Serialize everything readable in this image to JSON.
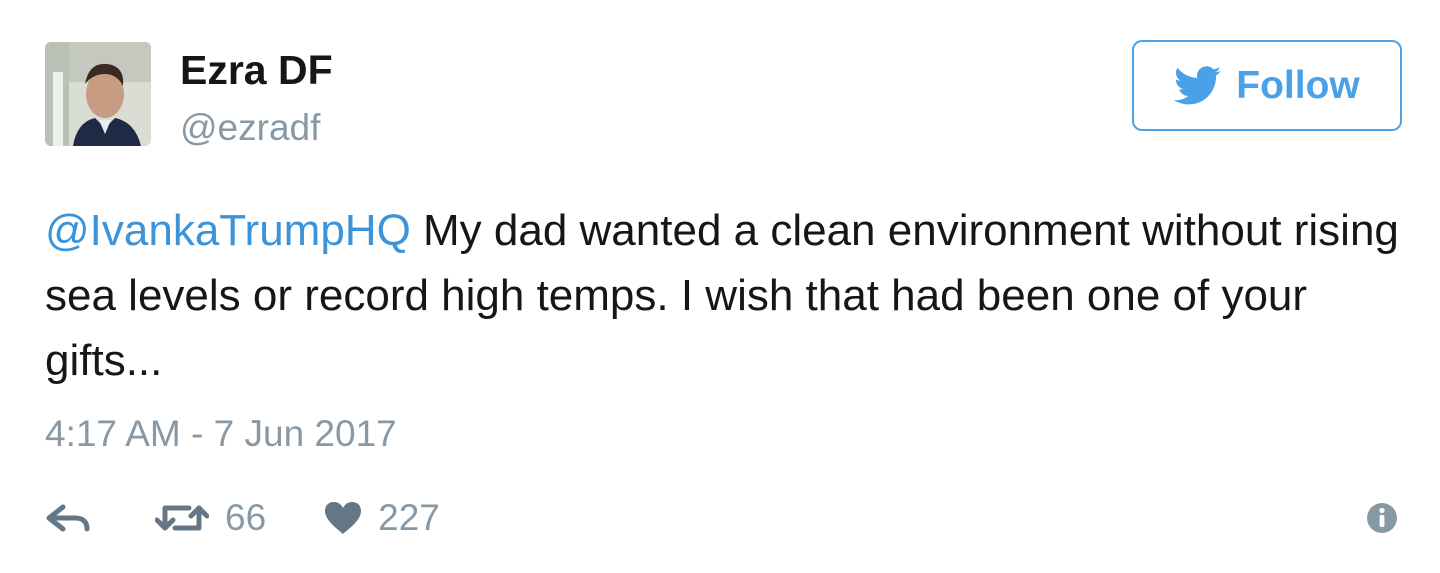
{
  "tweet": {
    "author": {
      "display_name": "Ezra DF",
      "handle": "@ezradf",
      "avatar_icon": "profile-photo"
    },
    "follow_button": {
      "label": "Follow",
      "icon": "twitter-bird-icon"
    },
    "text": {
      "mention": "@IvankaTrumpHQ",
      "body": " My dad wanted a clean environment without rising sea levels or record high temps. I wish that had been one of your gifts..."
    },
    "timestamp": "4:17 AM - 7 Jun 2017",
    "actions": {
      "reply_icon": "reply-icon",
      "retweet_icon": "retweet-icon",
      "retweet_count": "66",
      "like_icon": "heart-icon",
      "like_count": "227",
      "info_icon": "info-icon"
    },
    "colors": {
      "link": "#3b94d9",
      "follow_accent": "#4aa1e8",
      "meta_gray": "#8899a6",
      "icon_gray": "#657786",
      "text": "#14171a"
    }
  }
}
